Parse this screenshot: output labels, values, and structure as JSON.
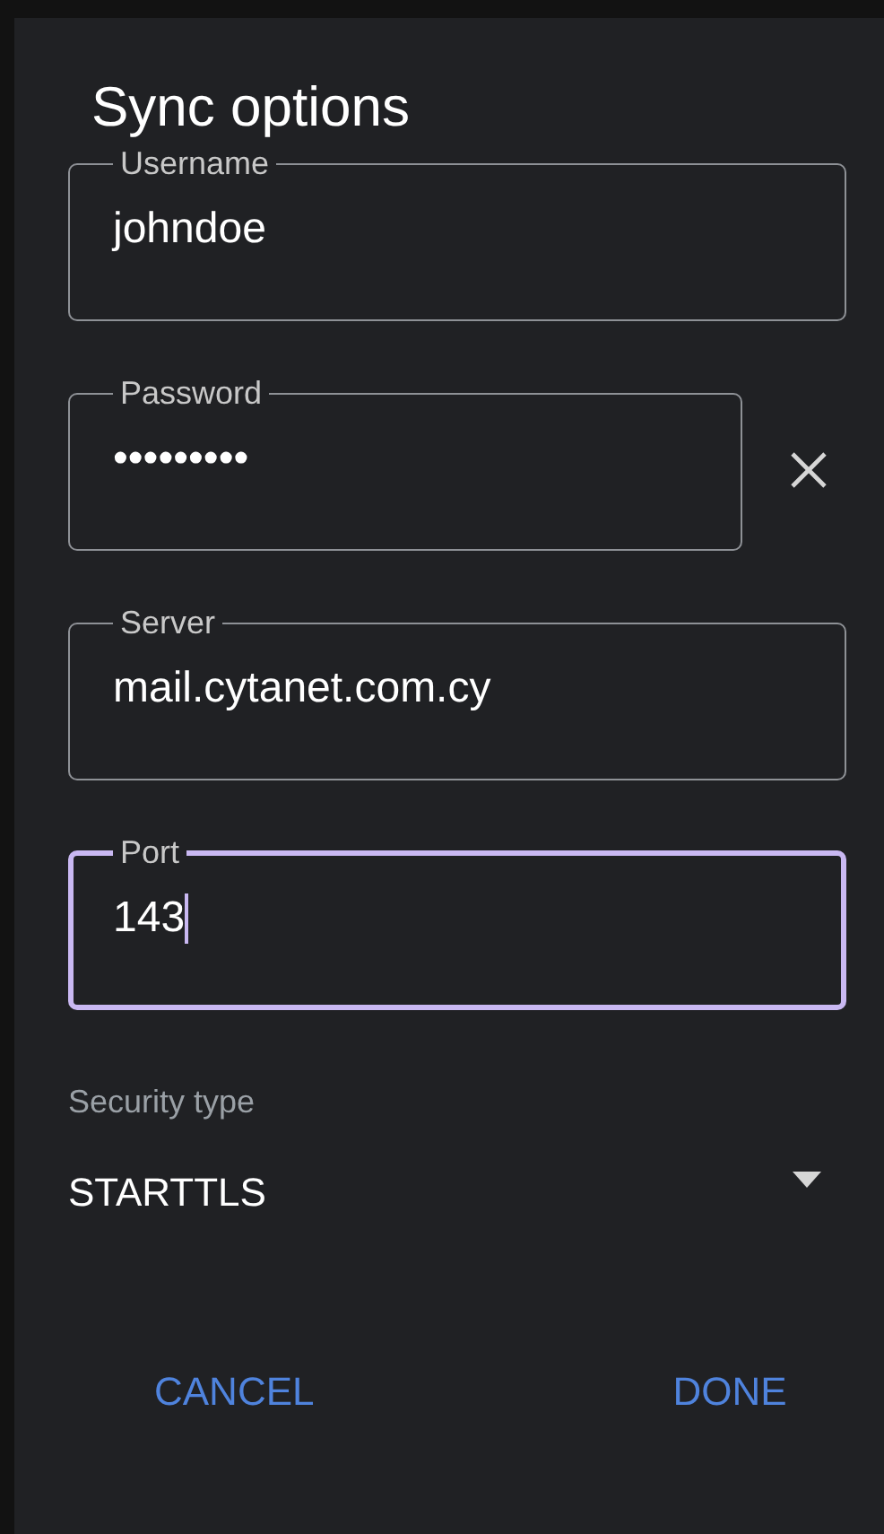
{
  "dialog": {
    "title": "Sync options"
  },
  "fields": [
    {
      "label": "Username",
      "value": "johndoe",
      "focused": false,
      "clear_button": false
    },
    {
      "label": "Password",
      "value": "•••••••••",
      "focused": false,
      "clear_button": true
    },
    {
      "label": "Server",
      "value": "mail.cytanet.com.cy",
      "focused": false,
      "clear_button": false
    },
    {
      "label": "Port",
      "value": "143",
      "focused": true,
      "clear_button": false
    }
  ],
  "security": {
    "label": "Security type",
    "value": "STARTTLS"
  },
  "buttons": [
    "CANCEL",
    "DONE"
  ]
}
